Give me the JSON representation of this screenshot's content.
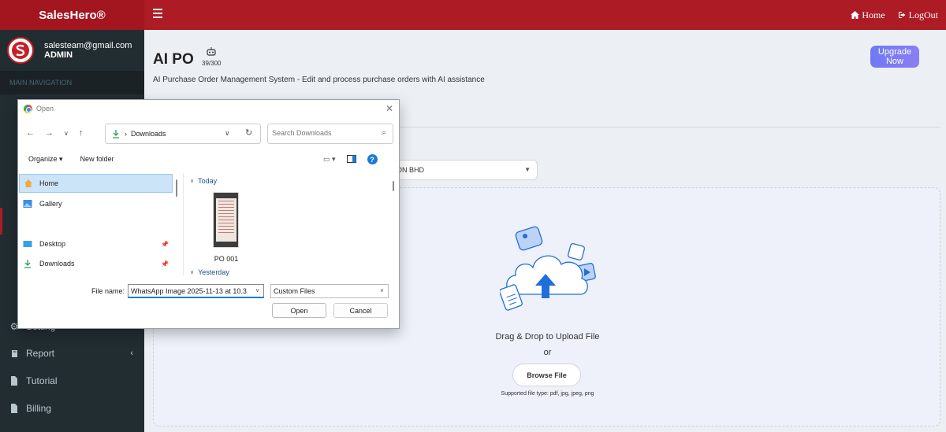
{
  "header": {
    "brand": "SalesHero®",
    "links": [
      {
        "label": "Home",
        "icon": "home-icon"
      },
      {
        "label": "LogOut",
        "icon": "logout-icon"
      }
    ]
  },
  "user": {
    "email": "salesteam@gmail.com",
    "role": "ADMIN"
  },
  "sidebar": {
    "nav_header": "MAIN NAVIGATION",
    "items": [
      {
        "label": "Setting",
        "icon": "gear-icon"
      },
      {
        "label": "Report",
        "icon": "book-icon",
        "has_children": true
      },
      {
        "label": "Tutorial",
        "icon": "document-icon"
      },
      {
        "label": "Billing",
        "icon": "document-icon"
      }
    ]
  },
  "page": {
    "title": "AI PO",
    "quota": "39/300",
    "subtitle": "AI Purchase Order Management System - Edit and process purchase orders with AI assistance",
    "upgrade_label": "Upgrade Now",
    "company_select": "ON BHD",
    "dropzone": {
      "main": "Drag & Drop to Upload File",
      "or": "or",
      "browse_label": "Browse File",
      "supported": "Supported file type: pdf, jpg, jpeg, png"
    }
  },
  "dialog": {
    "title": "Open",
    "path": "Downloads",
    "search_placeholder": "Search Downloads",
    "toolbar": {
      "organize": "Organize",
      "new_folder": "New folder"
    },
    "nav_items": [
      {
        "label": "Home",
        "icon": "home-folder-icon"
      },
      {
        "label": "Gallery",
        "icon": "gallery-icon"
      },
      {
        "label": "Desktop",
        "icon": "desktop-icon"
      },
      {
        "label": "Downloads",
        "icon": "download-icon"
      }
    ],
    "groups": {
      "today": "Today",
      "yesterday": "Yesterday"
    },
    "file": {
      "name": "PO 001"
    },
    "file_name_label": "File name:",
    "file_name_value": "WhatsApp Image 2025-11-13 at 10.3",
    "file_type": "Custom Files",
    "open_label": "Open",
    "cancel_label": "Cancel"
  },
  "colors": {
    "header": "#ad1b25",
    "sidebar": "#222d32",
    "accent": "#6f79f5",
    "upload_blue": "#1f6fdb"
  }
}
